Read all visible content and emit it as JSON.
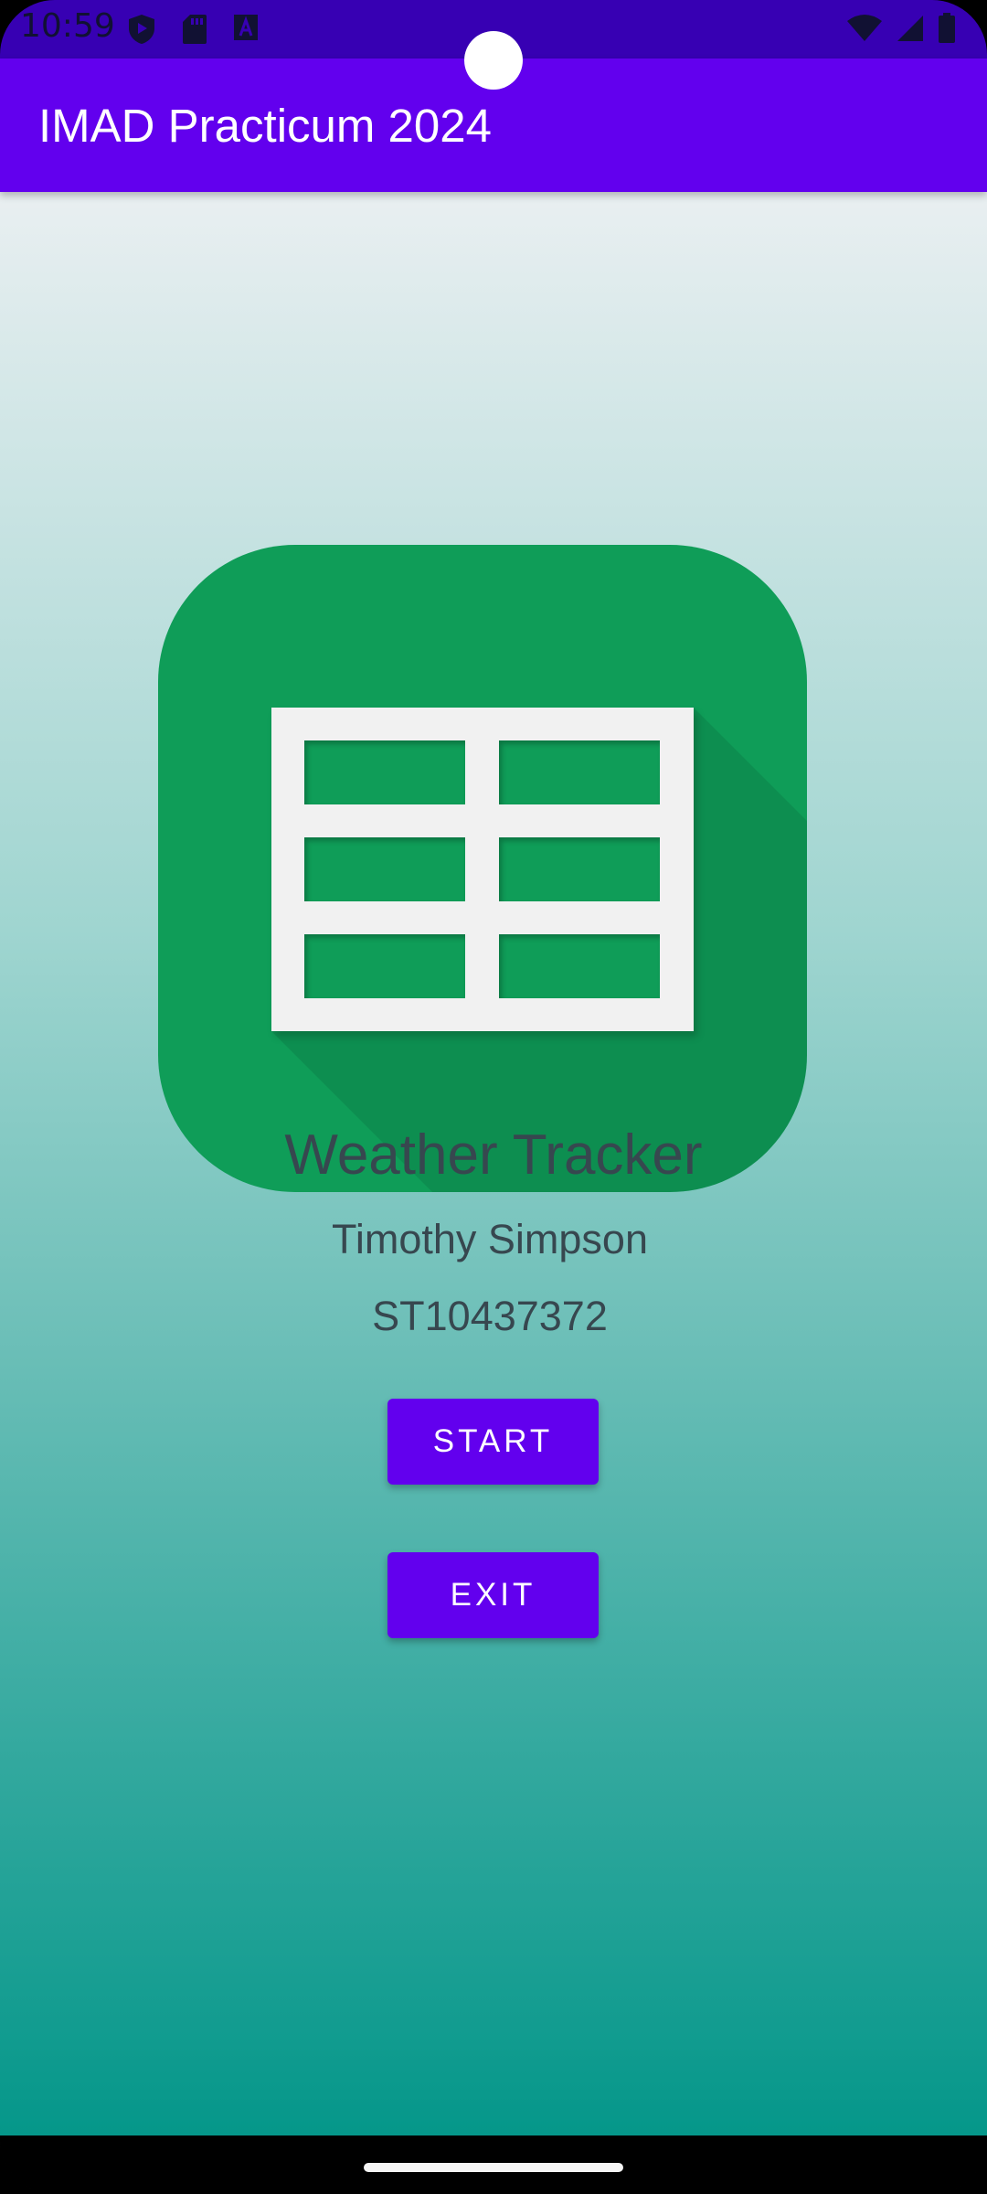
{
  "status_bar": {
    "time": "10:59",
    "left_icons": [
      "play-protect-icon",
      "sd-card-icon",
      "font-a-icon"
    ],
    "right_icons": [
      "wifi-icon",
      "signal-icon",
      "battery-icon"
    ],
    "color": "#3700b3"
  },
  "app_bar": {
    "title": "IMAD Practicum 2024",
    "color": "#6200ee"
  },
  "main": {
    "logo_icon": "spreadsheet-logo-icon",
    "app_name": "Weather Tracker",
    "author": "Timothy Simpson",
    "student_id": "ST10437372",
    "start_label": "START",
    "exit_label": "EXIT",
    "button_color": "#6200ee",
    "logo_color": "#0f9d58"
  }
}
